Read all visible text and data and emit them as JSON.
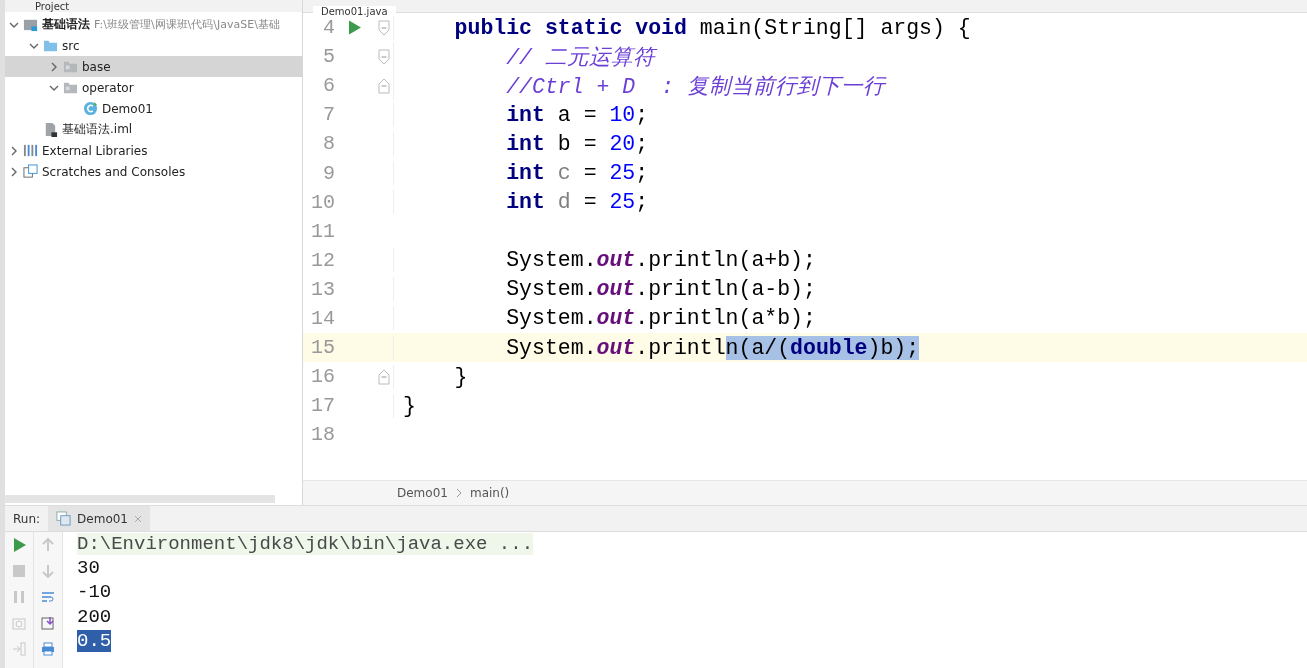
{
  "project_panel": {
    "title": "Project"
  },
  "tree": [
    {
      "label": "基础语法",
      "path": "F:\\班级管理\\网课班\\代码\\JavaSE\\基础",
      "kind": "module",
      "expanded": true,
      "selected": false,
      "children": [
        {
          "label": "src",
          "kind": "source-folder",
          "expanded": true,
          "selected": false,
          "children": [
            {
              "label": "base",
              "kind": "package",
              "expanded": false,
              "selected": true
            },
            {
              "label": "operator",
              "kind": "package",
              "expanded": true,
              "selected": false,
              "children": [
                {
                  "label": "Demo01",
                  "kind": "class",
                  "selected": false
                }
              ]
            }
          ]
        },
        {
          "label": "基础语法.iml",
          "kind": "file",
          "selected": false
        }
      ]
    },
    {
      "label": "External Libraries",
      "kind": "library",
      "expanded": false,
      "selected": false
    },
    {
      "label": "Scratches and Consoles",
      "kind": "scratch",
      "expanded": false,
      "selected": false
    }
  ],
  "editor_tab": {
    "label": "Demo01.java"
  },
  "code_lines": [
    {
      "number": "4",
      "run": true,
      "fold_start": true,
      "fold_end": false,
      "current": false,
      "tokens": [
        {
          "text": "    public static void ",
          "kind": "keyword",
          "selected": false
        },
        {
          "text": "main(String[] args) {",
          "kind": "plain",
          "selected": false
        }
      ]
    },
    {
      "number": "5",
      "run": false,
      "fold_start": true,
      "fold_end": false,
      "current": false,
      "tokens": [
        {
          "text": "        // 二元运算符",
          "kind": "comment",
          "selected": false
        }
      ]
    },
    {
      "number": "6",
      "run": false,
      "fold_start": false,
      "fold_end": true,
      "current": false,
      "tokens": [
        {
          "text": "        //Ctrl + D  : 复制当前行到下一行",
          "kind": "comment",
          "selected": false
        }
      ]
    },
    {
      "number": "7",
      "run": false,
      "fold_start": false,
      "fold_end": false,
      "current": false,
      "tokens": [
        {
          "text": "        int ",
          "kind": "keyword",
          "selected": false
        },
        {
          "text": "a = ",
          "kind": "plain",
          "selected": false
        },
        {
          "text": "10",
          "kind": "number",
          "selected": false
        },
        {
          "text": ";",
          "kind": "plain",
          "selected": false
        }
      ]
    },
    {
      "number": "8",
      "run": false,
      "fold_start": false,
      "fold_end": false,
      "current": false,
      "tokens": [
        {
          "text": "        int ",
          "kind": "keyword",
          "selected": false
        },
        {
          "text": "b = ",
          "kind": "plain",
          "selected": false
        },
        {
          "text": "20",
          "kind": "number",
          "selected": false
        },
        {
          "text": ";",
          "kind": "plain",
          "selected": false
        }
      ]
    },
    {
      "number": "9",
      "run": false,
      "fold_start": false,
      "fold_end": false,
      "current": false,
      "tokens": [
        {
          "text": "        int ",
          "kind": "keyword",
          "selected": false
        },
        {
          "text": "c",
          "kind": "unused",
          "selected": false
        },
        {
          "text": " = ",
          "kind": "plain",
          "selected": false
        },
        {
          "text": "25",
          "kind": "number",
          "selected": false
        },
        {
          "text": ";",
          "kind": "plain",
          "selected": false
        }
      ]
    },
    {
      "number": "10",
      "run": false,
      "fold_start": false,
      "fold_end": false,
      "current": false,
      "tokens": [
        {
          "text": "        int ",
          "kind": "keyword",
          "selected": false
        },
        {
          "text": "d",
          "kind": "unused",
          "selected": false
        },
        {
          "text": " = ",
          "kind": "plain",
          "selected": false
        },
        {
          "text": "25",
          "kind": "number",
          "selected": false
        },
        {
          "text": ";",
          "kind": "plain",
          "selected": false
        }
      ]
    },
    {
      "number": "11",
      "run": false,
      "fold_start": false,
      "fold_end": false,
      "current": false
    },
    {
      "number": "12",
      "run": false,
      "fold_start": false,
      "fold_end": false,
      "current": false,
      "tokens": [
        {
          "text": "        System.",
          "kind": "plain",
          "selected": false
        },
        {
          "text": "out",
          "kind": "static",
          "selected": false
        },
        {
          "text": ".println(a+b);",
          "kind": "plain",
          "selected": false
        }
      ]
    },
    {
      "number": "13",
      "run": false,
      "fold_start": false,
      "fold_end": false,
      "current": false,
      "tokens": [
        {
          "text": "        System.",
          "kind": "plain",
          "selected": false
        },
        {
          "text": "out",
          "kind": "static",
          "selected": false
        },
        {
          "text": ".println(a-b);",
          "kind": "plain",
          "selected": false
        }
      ]
    },
    {
      "number": "14",
      "run": false,
      "fold_start": false,
      "fold_end": false,
      "current": false,
      "tokens": [
        {
          "text": "        System.",
          "kind": "plain",
          "selected": false
        },
        {
          "text": "out",
          "kind": "static",
          "selected": false
        },
        {
          "text": ".println(a*b);",
          "kind": "plain",
          "selected": false
        }
      ]
    },
    {
      "number": "15",
      "run": false,
      "fold_start": false,
      "fold_end": false,
      "current": true,
      "tokens": [
        {
          "text": "        System.",
          "kind": "plain",
          "selected": false
        },
        {
          "text": "out",
          "kind": "static",
          "selected": false
        },
        {
          "text": ".printl",
          "kind": "plain",
          "selected": false
        },
        {
          "text": "n(a/(",
          "kind": "plain",
          "selected": true
        },
        {
          "text": "double",
          "kind": "keyword",
          "selected": true
        },
        {
          "text": ")b);",
          "kind": "plain",
          "selected": true
        }
      ]
    },
    {
      "number": "16",
      "run": false,
      "fold_start": false,
      "fold_end": true,
      "current": false,
      "tokens": [
        {
          "text": "    }",
          "kind": "plain",
          "selected": false
        }
      ]
    },
    {
      "number": "17",
      "run": false,
      "fold_start": false,
      "fold_end": false,
      "current": false,
      "tokens": [
        {
          "text": "}",
          "kind": "plain",
          "selected": false
        }
      ]
    },
    {
      "number": "18",
      "run": false,
      "fold_start": false,
      "fold_end": false,
      "current": false
    }
  ],
  "breadcrumb": [
    "Demo01",
    "main()"
  ],
  "run_panel": {
    "label": "Run:",
    "tab": "Demo01",
    "console": [
      {
        "text": "D:\\Environment\\jdk8\\jdk\\bin\\java.exe ...",
        "kind": "command",
        "selected": false
      },
      {
        "text": "30",
        "kind": "output",
        "selected": false
      },
      {
        "text": "-10",
        "kind": "output",
        "selected": false
      },
      {
        "text": "200",
        "kind": "output",
        "selected": false
      },
      {
        "text": "0.5",
        "kind": "output",
        "selected": true
      }
    ]
  }
}
